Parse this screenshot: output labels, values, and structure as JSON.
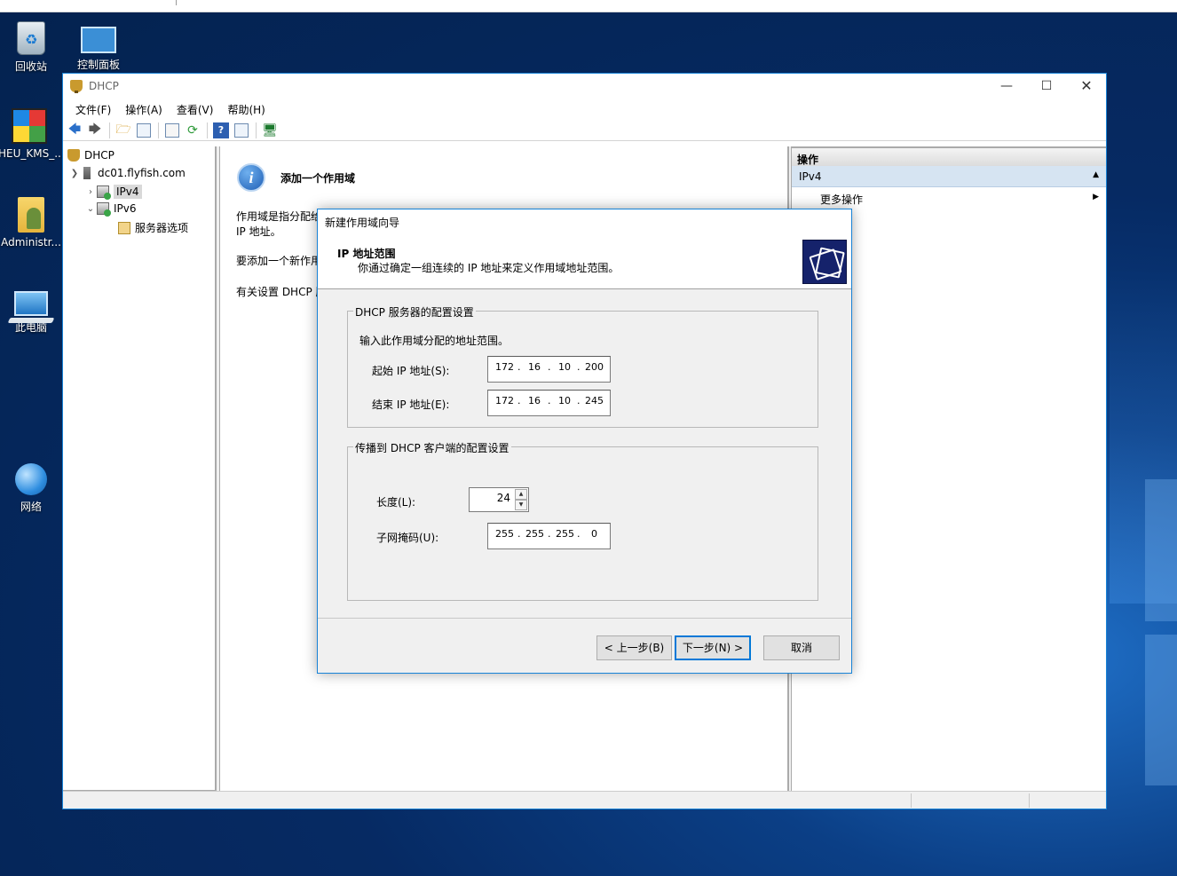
{
  "desktop": {
    "icons": [
      {
        "label": "回收站",
        "icon": "recycle-bin-icon"
      },
      {
        "label": "控制面板",
        "icon": "control-panel-icon"
      },
      {
        "label": "HEU_KMS_...",
        "icon": "heu-kms-icon"
      },
      {
        "label": "Administr...",
        "icon": "user-folder-icon"
      },
      {
        "label": "此电脑",
        "icon": "this-pc-icon"
      },
      {
        "label": "网络",
        "icon": "network-icon"
      }
    ]
  },
  "mmc": {
    "title": "DHCP",
    "menu": [
      "文件(F)",
      "操作(A)",
      "查看(V)",
      "帮助(H)"
    ],
    "tree": {
      "root": "DHCP",
      "server": "dc01.flyfish.com",
      "ipv4": "IPv4",
      "ipv6": "IPv6",
      "server_options": "服务器选项"
    },
    "center": {
      "heading": "添加一个作用域",
      "line1": "作用域是指分配给",
      "line2": "IP 地址。",
      "line3": "要添加一个新作用",
      "line4": "有关设置 DHCP 服"
    },
    "actions": {
      "header": "操作",
      "section": "IPv4",
      "more": "更多操作"
    }
  },
  "wizard": {
    "title": "新建作用域向导",
    "heading": "IP 地址范围",
    "subheading": "你通过确定一组连续的 IP 地址来定义作用域地址范围。",
    "group1": {
      "legend": "DHCP 服务器的配置设置",
      "instruction": "输入此作用域分配的地址范围。",
      "start_label": "起始 IP 地址(S):",
      "start_ip": [
        "172",
        "16",
        "10",
        "200"
      ],
      "end_label": "结束 IP 地址(E):",
      "end_ip": [
        "172",
        "16",
        "10",
        "245"
      ]
    },
    "group2": {
      "legend": "传播到 DHCP 客户端的配置设置",
      "length_label": "长度(L):",
      "length_value": "24",
      "mask_label": "子网掩码(U):",
      "mask": [
        "255",
        "255",
        "255",
        "0"
      ]
    },
    "buttons": {
      "back": "< 上一步(B)",
      "next": "下一步(N) >",
      "cancel": "取消"
    }
  }
}
